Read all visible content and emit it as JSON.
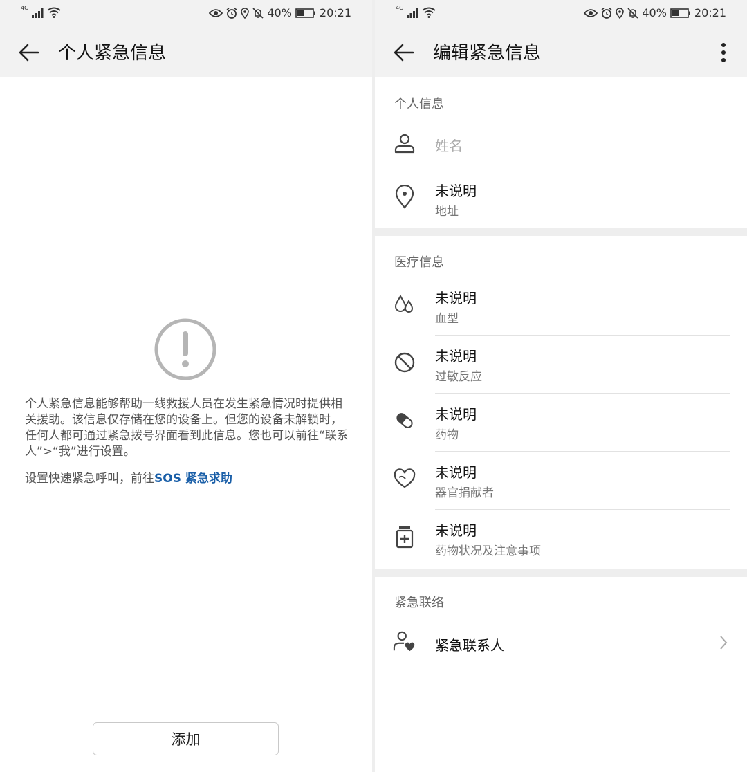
{
  "status_bar": {
    "network_type": "4G",
    "battery": "40%",
    "time": "20:21"
  },
  "left_screen": {
    "title": "个人紧急信息",
    "description": "个人紧急信息能够帮助一线救援人员在发生紧急情况时提供相关援助。该信息仅存储在您的设备上。但您的设备未解锁时，任何人都可通过紧急拨号界面看到此信息。您也可以前往“联系人”>“我”进行设置。",
    "sos_prefix": "设置快速紧急呼叫，前往",
    "sos_link": "SOS 紧急求助",
    "add_button": "添加",
    "icon": "alert-circle-icon"
  },
  "right_screen": {
    "title": "编辑紧急信息",
    "sections": {
      "personal": {
        "header": "个人信息",
        "name_placeholder": "姓名",
        "address_value": "未说明",
        "address_label": "地址"
      },
      "medical": {
        "header": "医疗信息",
        "items": [
          {
            "value": "未说明",
            "label": "血型",
            "icon": "blood-drop-icon"
          },
          {
            "value": "未说明",
            "label": "过敏反应",
            "icon": "prohibited-icon"
          },
          {
            "value": "未说明",
            "label": "药物",
            "icon": "pill-icon"
          },
          {
            "value": "未说明",
            "label": "器官捐献者",
            "icon": "heart-hand-icon"
          },
          {
            "value": "未说明",
            "label": "药物状况及注意事项",
            "icon": "medicine-bottle-icon"
          }
        ]
      },
      "emergency": {
        "header": "紧急联络",
        "contacts_label": "紧急联系人"
      }
    }
  }
}
